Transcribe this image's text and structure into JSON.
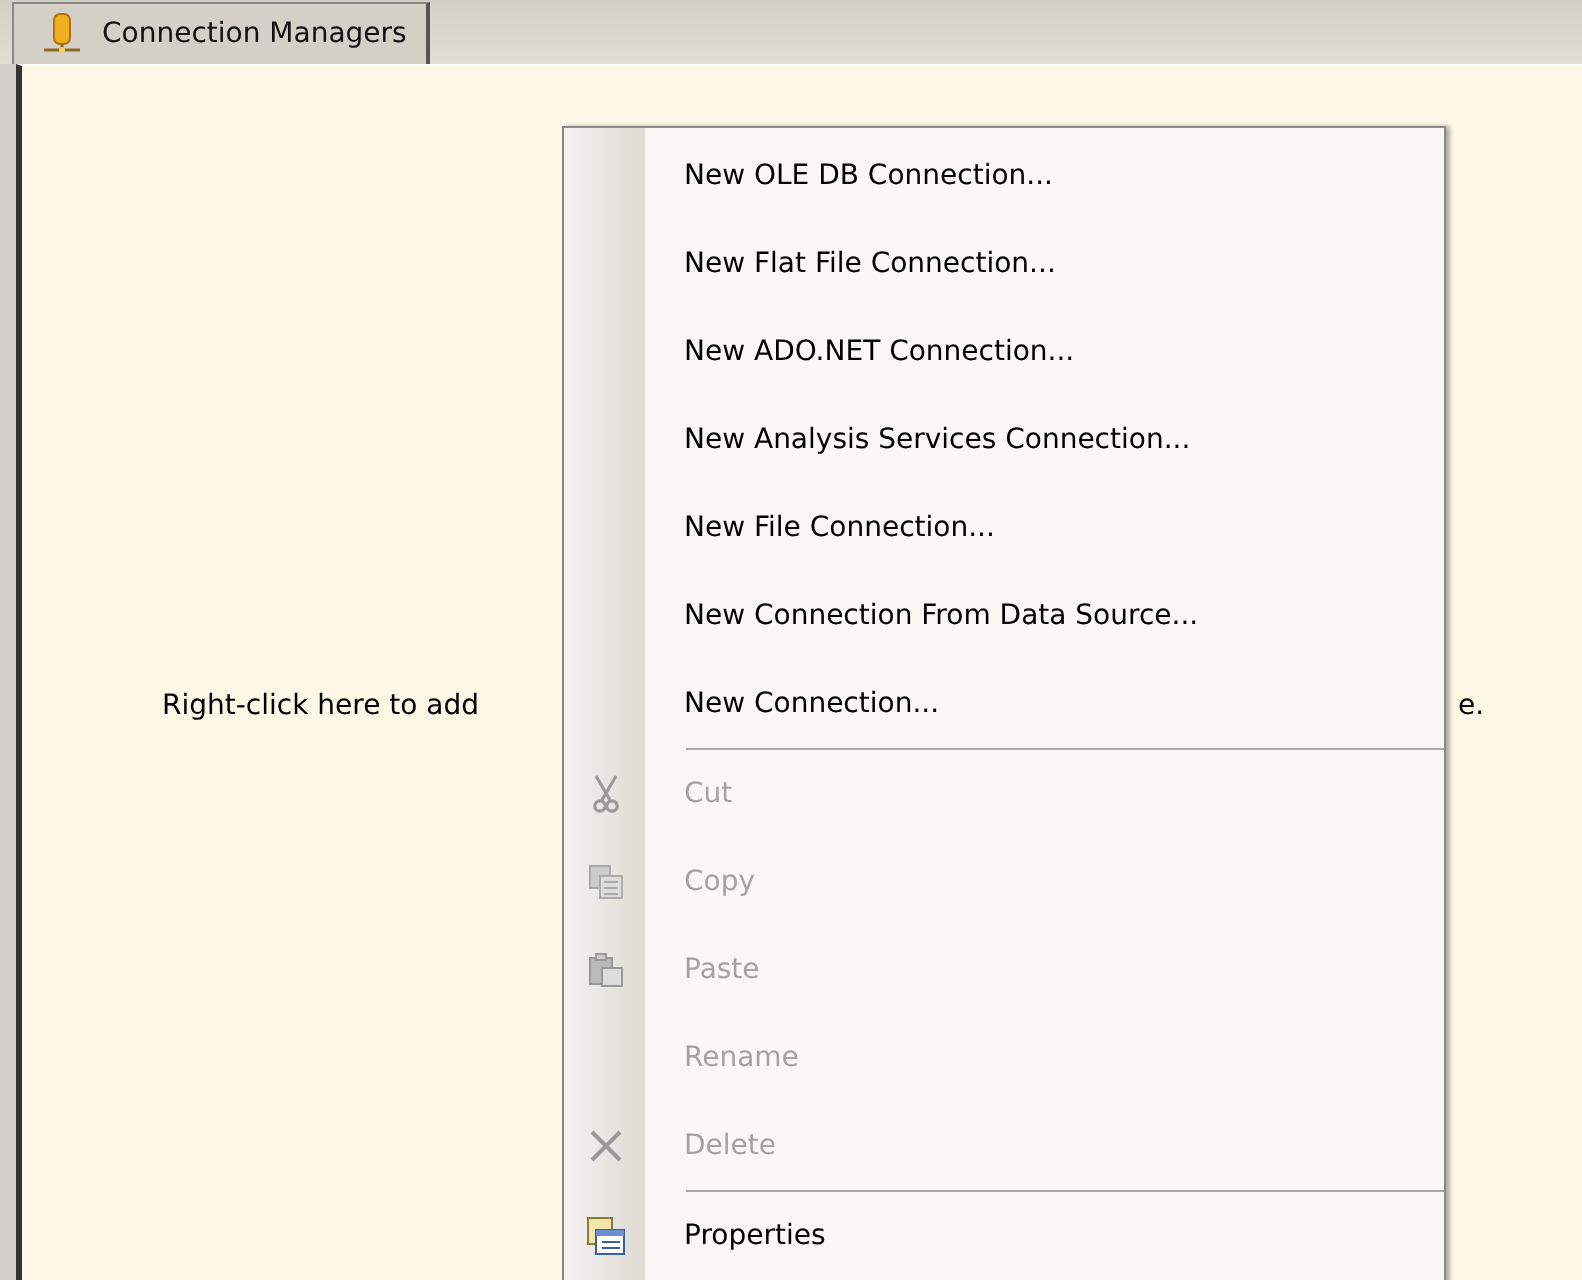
{
  "tabs": [
    {
      "label": "Connection Managers",
      "selected": true
    }
  ],
  "panel": {
    "hint_left": "Right-click here to add",
    "hint_right": "e."
  },
  "context_menu": {
    "items": [
      {
        "kind": "item",
        "label": "New OLE DB Connection...",
        "disabled": false
      },
      {
        "kind": "item",
        "label": "New Flat File Connection...",
        "disabled": false
      },
      {
        "kind": "item",
        "label": "New ADO.NET Connection...",
        "disabled": false
      },
      {
        "kind": "item",
        "label": "New Analysis Services Connection...",
        "disabled": false
      },
      {
        "kind": "item",
        "label": "New File Connection...",
        "disabled": false
      },
      {
        "kind": "item",
        "label": "New Connection From Data Source...",
        "disabled": false
      },
      {
        "kind": "item",
        "label": "New Connection...",
        "disabled": false
      },
      {
        "kind": "separator"
      },
      {
        "kind": "item",
        "label": "Cut",
        "disabled": true
      },
      {
        "kind": "item",
        "label": "Copy",
        "disabled": true
      },
      {
        "kind": "item",
        "label": "Paste",
        "disabled": true
      },
      {
        "kind": "item",
        "label": "Rename",
        "disabled": true
      },
      {
        "kind": "item",
        "label": "Delete",
        "disabled": true
      },
      {
        "kind": "separator"
      },
      {
        "kind": "item",
        "label": "Properties",
        "disabled": false
      }
    ]
  }
}
